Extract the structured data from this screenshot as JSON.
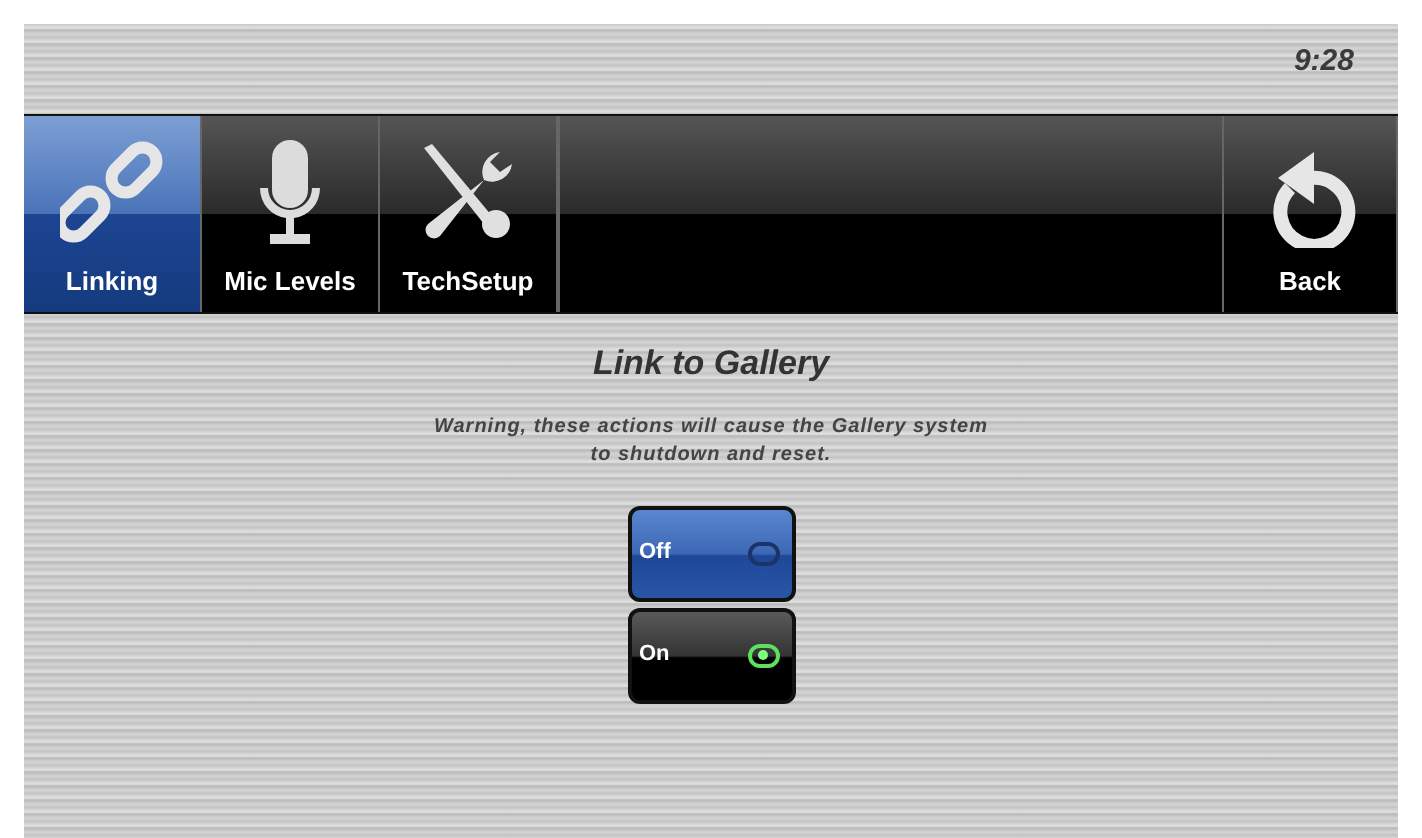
{
  "clock": "9:28",
  "nav": {
    "tabs": [
      {
        "label": "Linking",
        "selected": true
      },
      {
        "label": "Mic Levels",
        "selected": false
      },
      {
        "label": "TechSetup",
        "selected": false
      }
    ],
    "back": {
      "label": "Back"
    }
  },
  "panel": {
    "title": "Link to Gallery",
    "warning": "Warning, these actions will cause the Gallery system to shutdown and reset.",
    "options": [
      {
        "label": "Off",
        "selected": true,
        "lit": false
      },
      {
        "label": "On",
        "selected": false,
        "lit": true
      }
    ]
  }
}
